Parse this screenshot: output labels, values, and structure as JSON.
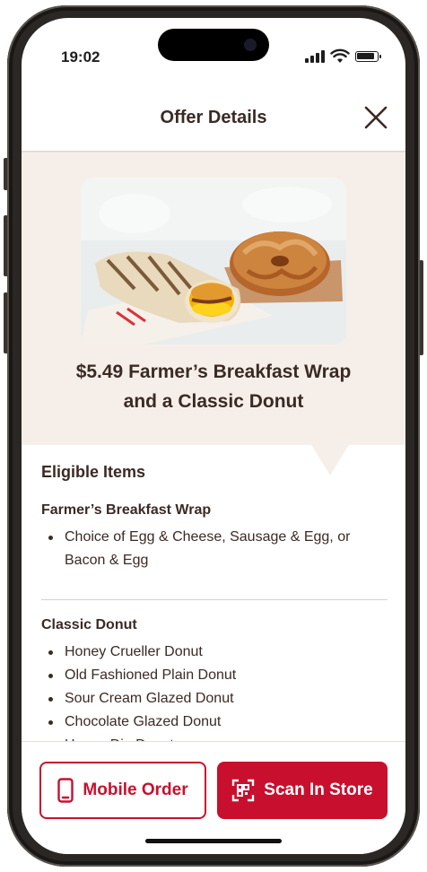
{
  "status_bar": {
    "time": "19:02"
  },
  "header": {
    "title": "Offer Details"
  },
  "offer": {
    "title": "$5.49 Farmer’s Breakfast Wrap and a Classic Donut"
  },
  "eligible": {
    "heading": "Eligible Items",
    "groups": [
      {
        "title": "Farmer’s Breakfast Wrap",
        "items": [
          "Choice of Egg & Cheese, Sausage & Egg, or Bacon & Egg"
        ]
      },
      {
        "title": "Classic Donut",
        "items": [
          "Honey Crueller Donut",
          "Old Fashioned Plain Donut",
          "Sour Cream Glazed Donut",
          "Chocolate Glazed Donut",
          "Honey Dip Donut"
        ]
      }
    ]
  },
  "actions": {
    "mobile_order": "Mobile Order",
    "scan_in_store": "Scan In Store"
  },
  "colors": {
    "brand_red": "#c8102e",
    "text_brown": "#3b2a24",
    "hero_bg": "#f6efe9"
  },
  "icons": {
    "close": "close-icon",
    "phone": "phone-icon",
    "scan": "scan-icon"
  }
}
